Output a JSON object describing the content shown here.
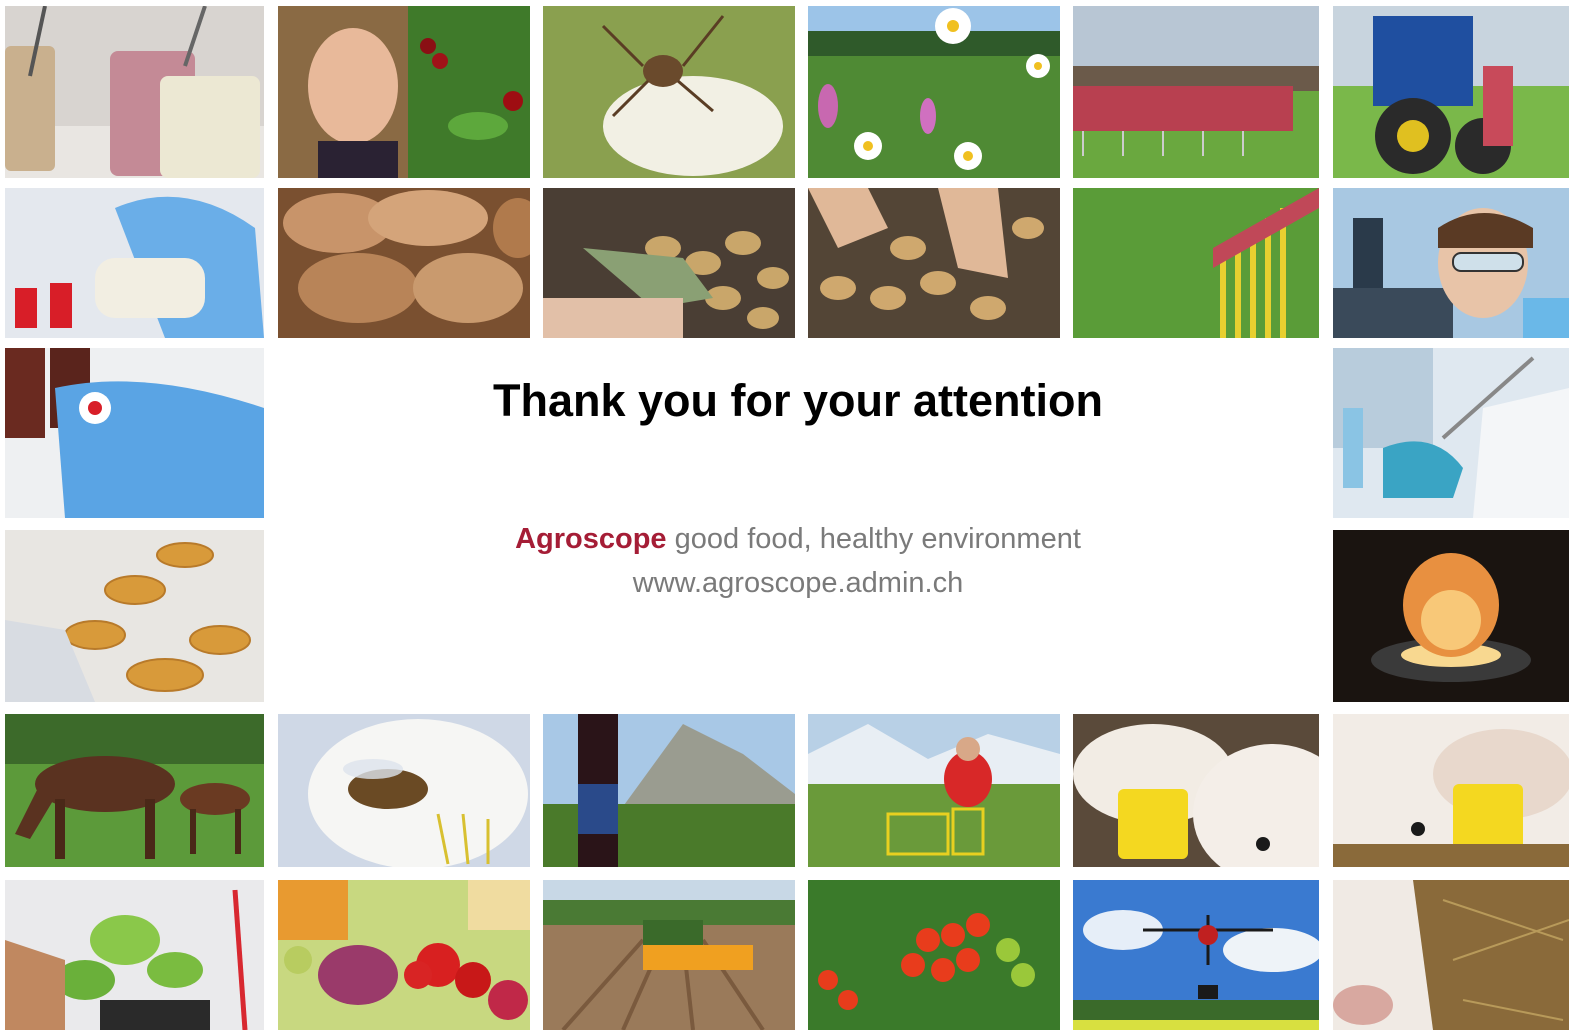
{
  "slide": {
    "title": "Thank you for your attention",
    "brand": "Agroscope",
    "tagline": "good food, healthy environment",
    "url": "www.agroscope.admin.ch"
  },
  "colors": {
    "brand": "#a51d36",
    "tagline": "#7a7a7a",
    "title": "#000000"
  },
  "photos": [
    "yogurt-jars",
    "woman-picking-cherries",
    "spider-on-blossom",
    "wildflower-meadow",
    "tractor-slurry-spreader",
    "blue-tractor",
    "lab-pouring-sample",
    "bread-loaves",
    "potato-sorting-gloves",
    "potato-sorting-hands",
    "field-spreader-hoses",
    "scientist-microscope",
    "lab-dropper-bottles",
    "lab-pipette-flask",
    "petri-dishes",
    "onion-candling-lamp",
    "horses-grazing",
    "bee-on-flower",
    "wine-bottle-vineyard",
    "alpine-field-researcher",
    "calf-ear-tag",
    "calf-ear-tag-closeup",
    "plant-seedling-pot",
    "vegetables-fruit-cheese",
    "tractor-planting-field",
    "tomatoes-greenhouse",
    "drone-sky",
    "calf-in-straw"
  ]
}
